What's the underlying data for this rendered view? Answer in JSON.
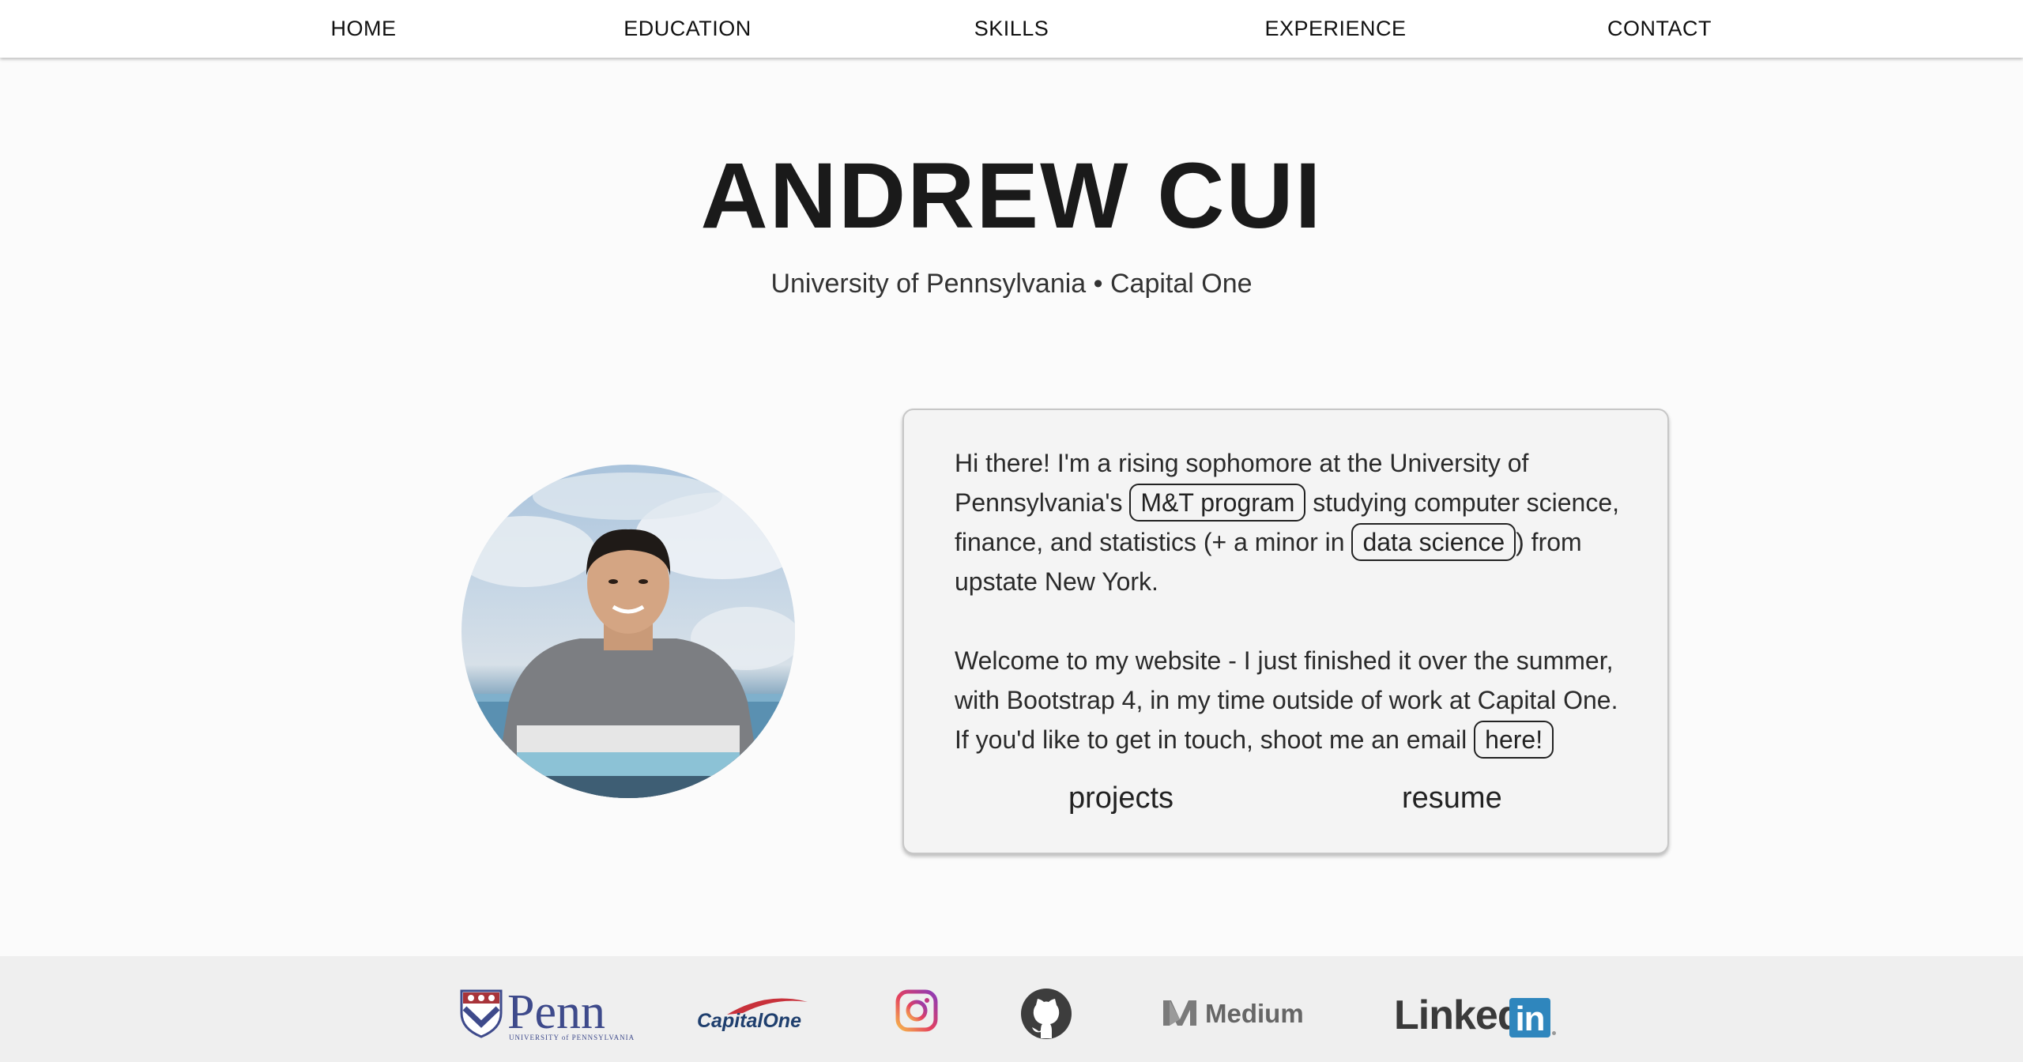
{
  "nav": {
    "items": [
      {
        "label": "HOME"
      },
      {
        "label": "EDUCATION"
      },
      {
        "label": "SKILLS"
      },
      {
        "label": "EXPERIENCE"
      },
      {
        "label": "CONTACT"
      }
    ]
  },
  "hero": {
    "name": "ANDREW CUI",
    "subtitle": "University of Pennsylvania • Capital One"
  },
  "about": {
    "p1_a": "Hi there! I'm a rising sophomore at the University of Pennsylvania's",
    "p1_link1": "M&T program",
    "p1_b": "studying computer science, finance, and statistics (+ a minor in",
    "p1_link2": "data science",
    "p1_c": ") from upstate New York.",
    "p2_a": "Welcome to my website - I just finished it over the summer, with Bootstrap 4, in my time outside of work at Capital One. If you'd like to get in touch, shoot me an email",
    "p2_link": "here!",
    "projects_label": "projects",
    "resume_label": "resume"
  },
  "footer": {
    "penn_word": "Penn",
    "penn_sub": "UNIVERSITY of PENNSYLVANIA",
    "capone_word": "CapitalOne",
    "medium_word": "Medium",
    "linkedin_word": "Linked",
    "linkedin_box": "in"
  },
  "colors": {
    "nav_bg": "#ffffff",
    "page_bg": "#fbfbfb",
    "card_bg": "#f4f4f4",
    "footer_bg": "#efefef",
    "penn_blue": "#3e4a8b",
    "linkedin_blue": "#2f86bd"
  },
  "icons": [
    "penn-logo-icon",
    "capital-one-logo-icon",
    "instagram-icon",
    "github-icon",
    "medium-icon",
    "linkedin-icon"
  ]
}
